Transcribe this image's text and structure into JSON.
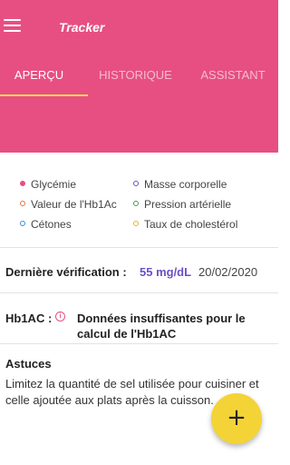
{
  "header": {
    "title": "Tracker",
    "menu_icon": "hamburger-menu-icon",
    "color": "#e74f82"
  },
  "tabs": [
    {
      "label": "APERÇU",
      "active": true
    },
    {
      "label": "HISTORIQUE",
      "active": false
    },
    {
      "label": "ASSISTANT",
      "active": false
    }
  ],
  "tab_indicator_color": "#f3d74a",
  "legend": {
    "items": [
      {
        "label": "Glycémie",
        "color": "#e74f82",
        "filled": true
      },
      {
        "label": "Masse corporelle",
        "color": "#6b4fc8",
        "filled": false
      },
      {
        "label": "Valeur de l'Hb1Ac",
        "color": "#e8733a",
        "filled": false
      },
      {
        "label": "Pression artérielle",
        "color": "#4f9a4a",
        "filled": false
      },
      {
        "label": "Cétones",
        "color": "#3b8fd6",
        "filled": false
      },
      {
        "label": "Taux de cholestérol",
        "color": "#e2b52e",
        "filled": false
      }
    ]
  },
  "last_check": {
    "label": "Dernière vérification :",
    "value": "55 mg/dL",
    "value_color": "#6b4fc8",
    "date": "20/02/2020"
  },
  "hb1ac": {
    "label": "Hb1AC :",
    "info_icon": "info-circle-icon",
    "message": "Données insuffisantes pour le calcul de l'Hb1AC"
  },
  "tips": {
    "title": "Astuces",
    "text": "Limitez la quantité de sel utilisée pour cuisiner et celle ajoutée aux plats après la cuisson."
  },
  "fab": {
    "icon": "plus-icon",
    "label": "+",
    "color": "#f4d337"
  }
}
